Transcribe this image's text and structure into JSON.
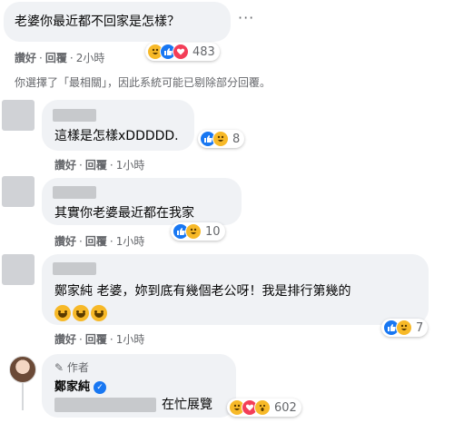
{
  "comments": [
    {
      "text": "老婆你最近都不回家是怎樣？",
      "reaction_count": "483",
      "actions": {
        "like": "讚好",
        "reply": "回覆",
        "time": "2小時"
      }
    },
    {
      "text": "這樣是怎樣xDDDDD.",
      "reaction_count": "8",
      "actions": {
        "like": "讚好",
        "reply": "回覆",
        "time": "1小時"
      }
    },
    {
      "text": "其實你老婆最近都在我家",
      "reaction_count": "10",
      "actions": {
        "like": "讚好",
        "reply": "回覆",
        "time": "1小時"
      }
    },
    {
      "text": "鄭家純 老婆，妳到底有幾個老公呀！我是排行第幾的",
      "reaction_count": "7",
      "actions": {
        "like": "讚好",
        "reply": "回覆",
        "time": "1小時"
      }
    },
    {
      "author_badge": "作者",
      "author_name": "鄭家純",
      "text": "在忙展覽",
      "reaction_count": "602"
    }
  ],
  "filter_note": "你選擇了「最相關」，因此系統可能已剔除部分回覆。",
  "more_label": "···",
  "colors": {
    "bubble": "#f0f2f5",
    "like": "#1877f2",
    "haha": "#f7b928",
    "love": "#f33e58",
    "meta": "#65676b"
  }
}
